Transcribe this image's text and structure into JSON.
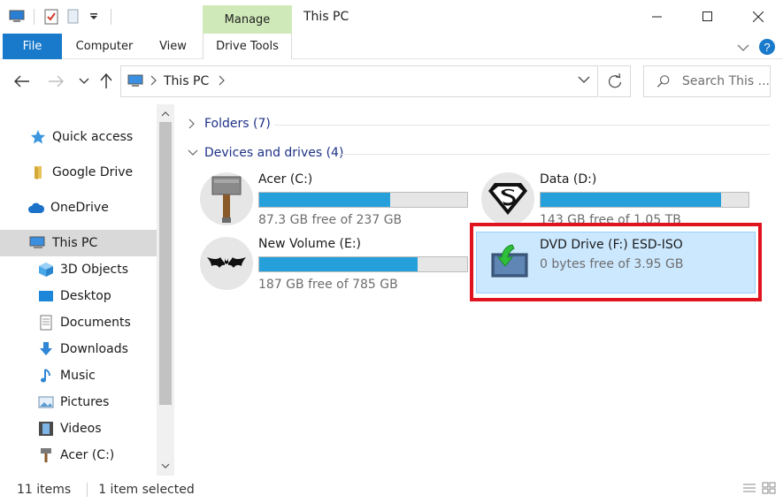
{
  "window": {
    "title": "This PC",
    "context_tab": "Manage"
  },
  "ribbon": {
    "tabs": [
      "File",
      "Computer",
      "View",
      "Drive Tools"
    ]
  },
  "address": {
    "location": "This PC",
    "search_placeholder": "Search This ..."
  },
  "sidebar": {
    "items": [
      {
        "label": "Quick access",
        "icon": "star-icon"
      },
      {
        "label": "Google Drive",
        "icon": "folder-icon"
      },
      {
        "label": "OneDrive",
        "icon": "cloud-icon"
      },
      {
        "label": "This PC",
        "icon": "computer-icon"
      },
      {
        "label": "3D Objects",
        "icon": "cube-icon"
      },
      {
        "label": "Desktop",
        "icon": "desktop-icon"
      },
      {
        "label": "Documents",
        "icon": "document-icon"
      },
      {
        "label": "Downloads",
        "icon": "download-arrow-icon"
      },
      {
        "label": "Music",
        "icon": "music-note-icon"
      },
      {
        "label": "Pictures",
        "icon": "picture-icon"
      },
      {
        "label": "Videos",
        "icon": "film-icon"
      },
      {
        "label": "Acer (C:)",
        "icon": "hammer-icon"
      }
    ],
    "selected": "This PC"
  },
  "content": {
    "groups": {
      "folders": "Folders (7)",
      "devices": "Devices and drives (4)"
    },
    "drives": [
      {
        "name": "Acer (C:)",
        "free": "87.3 GB free of 237 GB",
        "used_fraction": 0.63,
        "icon": "hammer-icon"
      },
      {
        "name": "Data (D:)",
        "free": "143 GB free of 1.05 TB",
        "used_fraction": 0.87,
        "icon": "superman-logo-icon"
      },
      {
        "name": "New Volume (E:)",
        "free": "187 GB free of 785 GB",
        "used_fraction": 0.76,
        "icon": "batman-logo-icon"
      }
    ],
    "dvd": {
      "name": "DVD Drive (F:) ESD-ISO",
      "free": "0 bytes free of 3.95 GB",
      "icon": "dvd-install-icon"
    }
  },
  "status": {
    "items": "11 items",
    "selected": "1 item selected"
  },
  "colors": {
    "accent": "#1979ca",
    "bar_fill": "#26a0da",
    "selection": "#cce8ff",
    "highlight": "#e0141e",
    "manage_tab": "#cfe9b8"
  }
}
